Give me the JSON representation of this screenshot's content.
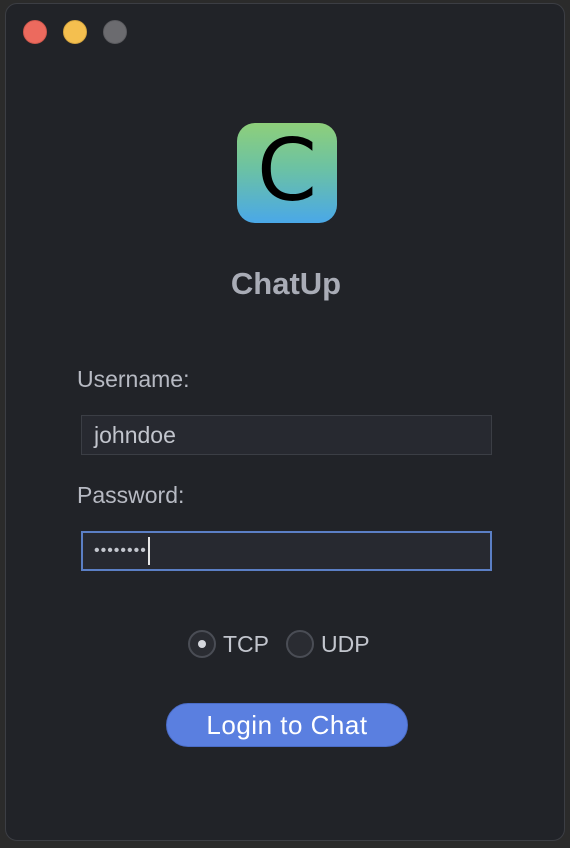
{
  "window": {
    "controls": [
      "close",
      "minimize",
      "zoom"
    ]
  },
  "app": {
    "icon_letter": "C",
    "title": "ChatUp",
    "icon_gradient": [
      "#8ecf7a",
      "#4aa8e8"
    ]
  },
  "form": {
    "username_label": "Username:",
    "username_value": "johndoe",
    "password_label": "Password:",
    "password_value": "••••••••"
  },
  "protocol": {
    "options": [
      {
        "label": "TCP",
        "selected": true
      },
      {
        "label": "UDP",
        "selected": false
      }
    ]
  },
  "actions": {
    "login_label": "Login to Chat"
  },
  "colors": {
    "window_bg": "#212328",
    "accent": "#5a7fe0",
    "focus_border": "#5b7fc5",
    "close": "#ec6a5e",
    "minimize": "#f4bf4f",
    "zoom": "#6b6b6f"
  }
}
